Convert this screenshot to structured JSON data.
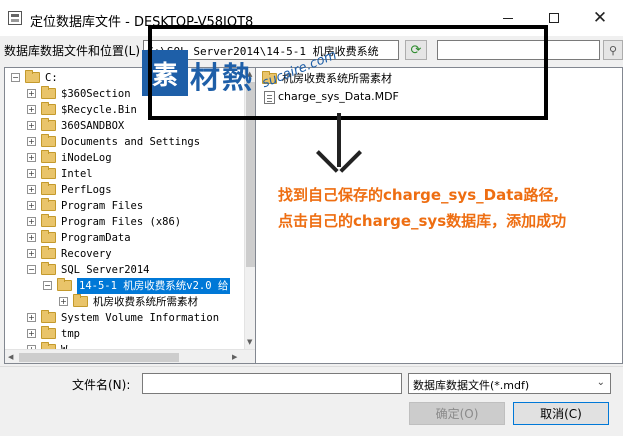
{
  "window": {
    "title": "定位数据库文件 - DESKTOP-V58IOT8",
    "minimize": "—",
    "maximize": "☐",
    "close": "✕"
  },
  "location": {
    "label": "数据库数据文件和位置(L)",
    "path": "C:\\SQL Server2014\\14-5-1 机房收费系统",
    "search_value": ""
  },
  "tree": {
    "root": "C:",
    "items": [
      "$360Section",
      "$Recycle.Bin",
      "360SANDBOX",
      "Documents and Settings",
      "iNodeLog",
      "Intel",
      "PerfLogs",
      "Program Files",
      "Program Files (x86)",
      "ProgramData",
      "Recovery",
      "SQL Server2014"
    ],
    "selected": "14-5-1 机房收费系统v2.0 给",
    "child": "机房收费系统所需素材",
    "after": [
      "System Volume Information",
      "tmp",
      "W"
    ]
  },
  "files": [
    {
      "name": "机房收费系统所需素材",
      "kind": "folder"
    },
    {
      "name": "charge_sys_Data.MDF",
      "kind": "mdf"
    }
  ],
  "annotation": {
    "text": "找到自己保存的charge_sys_Data路径,点击自己的charge_sys数据库，添加成功"
  },
  "watermark": {
    "logo": "素",
    "text": "材熱",
    "sub": "sucaire.com"
  },
  "bottom": {
    "filename_label": "文件名(N):",
    "filename_value": "",
    "filetype": "数据库数据文件(*.mdf)",
    "ok_label": "确定(O)",
    "cancel_label": "取消(C)"
  },
  "colors": {
    "accent": "#0078d7",
    "annotation": "#ee6e12",
    "watermark": "#1e5fa8"
  }
}
